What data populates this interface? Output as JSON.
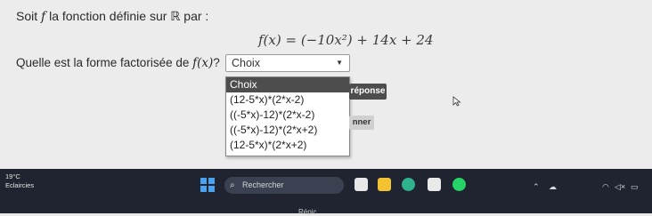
{
  "exercise": {
    "intro_prefix": "Soit",
    "intro_function": "f",
    "intro_middle": "la fonction définie sur",
    "intro_set": "ℝ",
    "intro_suffix": "par :",
    "formula": "f(x) = (−10x²) + 14x + 24",
    "question_text": "Quelle est la forme factorisée de",
    "question_math": "f(x)",
    "question_mark": "?"
  },
  "select": {
    "value": "Choix",
    "options": [
      "Choix",
      "(12-5*x)*(2*x-2)",
      "((-5*x)-12)*(2*x-2)",
      "((-5*x)-12)*(2*x+2)",
      "(12-5*x)*(2*x+2)"
    ]
  },
  "buttons": {
    "reponse": "réponse",
    "partial": "nner"
  },
  "taskbar": {
    "temperature": "19°C",
    "weather": "Eclaircies",
    "search_placeholder": "Rechercher",
    "partial_text": "Répic"
  },
  "colors": {
    "page_bg": "#ececec",
    "selected_option_bg": "#4d4d4d",
    "taskbar_bg": "#1f2430",
    "windows_blue": "#4aa3f0"
  }
}
